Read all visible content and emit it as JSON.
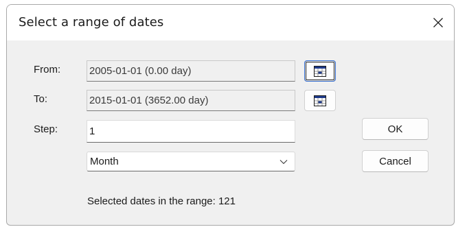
{
  "dialog": {
    "title": "Select a range of dates",
    "close_icon": "close-icon"
  },
  "from": {
    "label": "From:",
    "value": "2005-01-01 (0.00 day)",
    "picker_icon": "calendar-icon"
  },
  "to": {
    "label": "To:",
    "value": "2015-01-01 (3652.00 day)",
    "picker_icon": "calendar-icon"
  },
  "step": {
    "label": "Step:",
    "value": "1",
    "unit_selected": "Month"
  },
  "buttons": {
    "ok": "OK",
    "cancel": "Cancel"
  },
  "summary": "Selected dates in the range: 121",
  "colors": {
    "dialog_background": "#f0f0f0",
    "title_background": "#ffffff",
    "focus_border": "#2a64c8",
    "calendar_accent": "#1e3a8a"
  }
}
